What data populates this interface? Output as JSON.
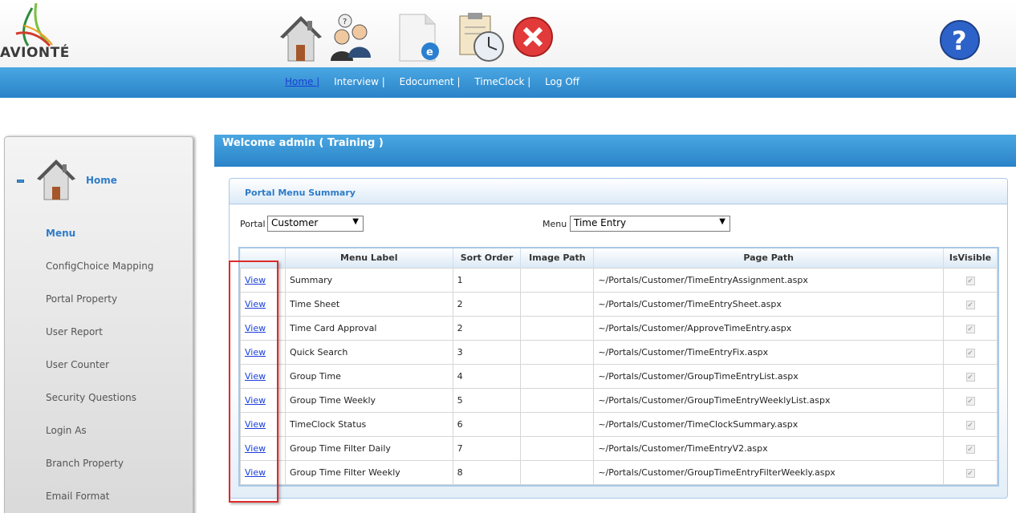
{
  "brand": {
    "name": "AVIONTÉ"
  },
  "nav": {
    "links": [
      "Home |",
      "Interview |",
      "Edocument |",
      "TimeClock |",
      "Log Off"
    ]
  },
  "sidebar": {
    "home_label": "Home",
    "items": [
      "Menu",
      "ConfigChoice Mapping",
      "Portal Property",
      "User Report",
      "User Counter",
      "Security Questions",
      "Login As",
      "Branch Property",
      "Email Format"
    ]
  },
  "welcome": "Welcome admin ( Training )",
  "panel_title": "Portal Menu Summary",
  "filters": {
    "portal_label": "Portal",
    "portal_value": "Customer",
    "menu_label": "Menu",
    "menu_value": "Time Entry"
  },
  "table": {
    "columns": [
      "",
      "Menu Label",
      "Sort Order",
      "Image Path",
      "Page Path",
      "IsVisible"
    ],
    "rows": [
      {
        "action": "View",
        "label": "Summary",
        "sort": "1",
        "image": "",
        "path": "~/Portals/Customer/TimeEntryAssignment.aspx",
        "visible": true
      },
      {
        "action": "View",
        "label": "Time Sheet",
        "sort": "2",
        "image": "",
        "path": "~/Portals/Customer/TimeEntrySheet.aspx",
        "visible": true
      },
      {
        "action": "View",
        "label": "Time Card Approval",
        "sort": "2",
        "image": "",
        "path": "~/Portals/Customer/ApproveTimeEntry.aspx",
        "visible": true
      },
      {
        "action": "View",
        "label": "Quick Search",
        "sort": "3",
        "image": "",
        "path": "~/Portals/Customer/TimeEntryFix.aspx",
        "visible": true
      },
      {
        "action": "View",
        "label": "Group Time",
        "sort": "4",
        "image": "",
        "path": "~/Portals/Customer/GroupTimeEntryList.aspx",
        "visible": true
      },
      {
        "action": "View",
        "label": "Group Time Weekly",
        "sort": "5",
        "image": "",
        "path": "~/Portals/Customer/GroupTimeEntryWeeklyList.aspx",
        "visible": true
      },
      {
        "action": "View",
        "label": "TimeClock Status",
        "sort": "6",
        "image": "",
        "path": "~/Portals/Customer/TimeClockSummary.aspx",
        "visible": true
      },
      {
        "action": "View",
        "label": "Group Time Filter Daily",
        "sort": "7",
        "image": "",
        "path": "~/Portals/Customer/TimeEntryV2.aspx",
        "visible": true
      },
      {
        "action": "View",
        "label": "Group Time Filter Weekly",
        "sort": "8",
        "image": "",
        "path": "~/Portals/Customer/GroupTimeEntryFilterWeekly.aspx",
        "visible": true
      }
    ]
  },
  "colors": {
    "accent_blue": "#2a83c8",
    "link_blue": "#1a3fd6",
    "highlight_red": "#e02a2a"
  },
  "icons": [
    "home-icon",
    "interview-icon",
    "edocument-icon",
    "timeclock-icon",
    "logoff-icon",
    "help-icon"
  ]
}
